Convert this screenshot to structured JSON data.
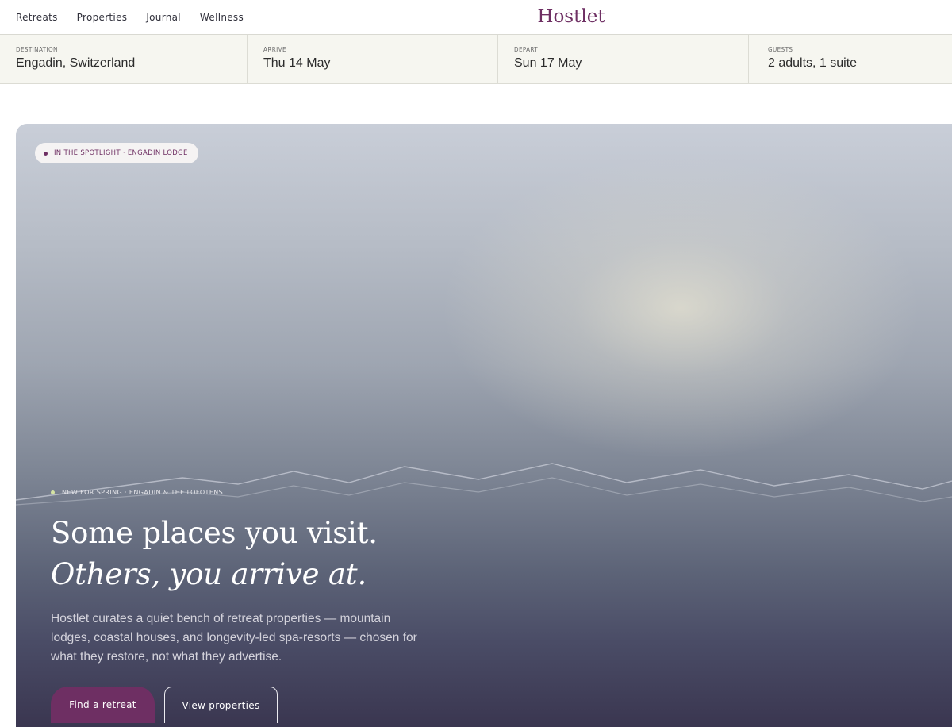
{
  "nav": {
    "items": [
      "Retreats",
      "Properties",
      "Journal",
      "Wellness"
    ]
  },
  "brand": {
    "name": "Hostlet",
    "color": "#6e2f63"
  },
  "search": {
    "destination": {
      "label": "DESTINATION",
      "value": "Engadin, Switzerland"
    },
    "arrive": {
      "label": "ARRIVE",
      "value": "Thu 14 May"
    },
    "depart": {
      "label": "DEPART",
      "value": "Sun 17 May"
    },
    "guests": {
      "label": "GUESTS",
      "value": "2 adults, 1 suite"
    }
  },
  "hero": {
    "spotlight": "IN THE SPOTLIGHT · ENGADIN LODGE",
    "eyebrow": "NEW FOR SPRING · ENGADIN & THE LOFOTENS",
    "headline_line1": "Some places you visit.",
    "headline_line2": "Others, you arrive at.",
    "lede": "Hostlet curates a quiet bench of retreat properties — mountain lodges, coastal houses, and longevity-led spa-resorts — chosen for what they restore, not what they advertise.",
    "primary_cta": "Find a retreat",
    "secondary_cta": "View properties"
  },
  "colors": {
    "accent": "#6e2f63",
    "eyebrow_dot": "#d4e3a2",
    "search_bg": "#f6f6f0"
  }
}
